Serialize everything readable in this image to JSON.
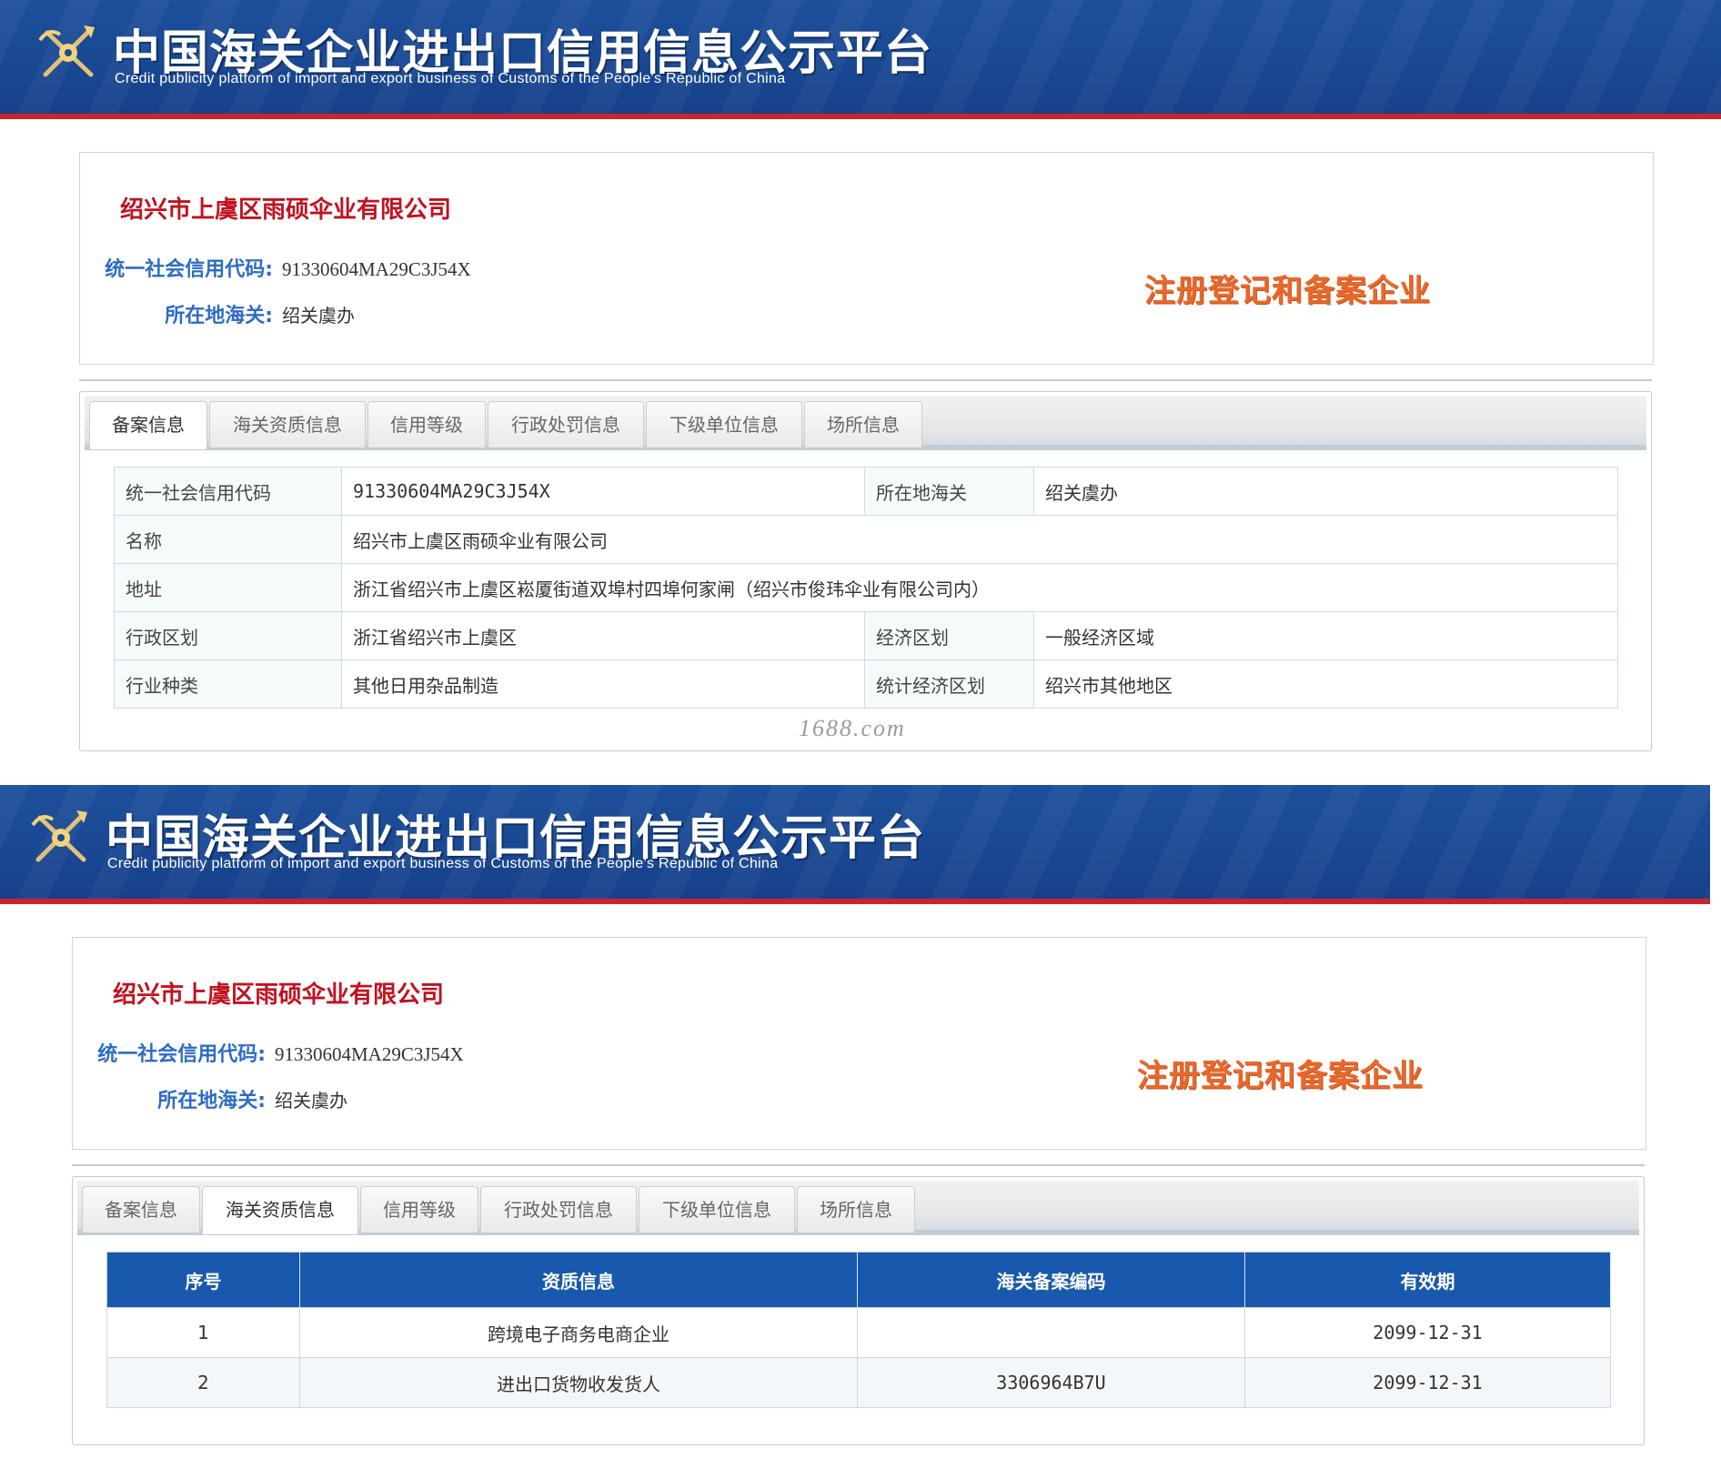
{
  "site": {
    "title": "中国海关企业进出口信用信息公示平台",
    "subtitle": "Credit publicity platform of import and export business of Customs of the People's Republic of China"
  },
  "company": {
    "name": "绍兴市上虞区雨硕伞业有限公司",
    "credit_code_label": "统一社会信用代码:",
    "credit_code": "91330604MA29C3J54X",
    "customs_label": "所在地海关:",
    "customs": "绍关虞办",
    "registration_badge": "注册登记和备案企业"
  },
  "tabs": [
    {
      "label": "备案信息"
    },
    {
      "label": "海关资质信息"
    },
    {
      "label": "信用等级"
    },
    {
      "label": "行政处罚信息"
    },
    {
      "label": "下级单位信息"
    },
    {
      "label": "场所信息"
    }
  ],
  "record": {
    "credit_code_label": "统一社会信用代码",
    "credit_code": "91330604MA29C3J54X",
    "customs_label": "所在地海关",
    "customs": "绍关虞办",
    "name_label": "名称",
    "name": "绍兴市上虞区雨硕伞业有限公司",
    "address_label": "地址",
    "address": "浙江省绍兴市上虞区崧厦街道双埠村四埠何家闸（绍兴市俊玮伞业有限公司内）",
    "admin_region_label": "行政区划",
    "admin_region": "浙江省绍兴市上虞区",
    "economic_region_label": "经济区划",
    "economic_region": "一般经济区域",
    "industry_label": "行业种类",
    "industry": "其他日用杂品制造",
    "stat_region_label": "统计经济区划",
    "stat_region": "绍兴市其他地区"
  },
  "watermark": "1688.com",
  "qualification": {
    "headers": [
      "序号",
      "资质信息",
      "海关备案编码",
      "有效期"
    ],
    "rows": [
      [
        "1",
        "跨境电子商务电商企业",
        "",
        "2099-12-31"
      ],
      [
        "2",
        "进出口货物收发货人",
        "3306964B7U",
        "2099-12-31"
      ]
    ]
  },
  "colors": {
    "banner": "#1a4a95",
    "banner_stripe": "#c9252b",
    "company_name": "#c1121f",
    "label_blue": "#2c6cc6",
    "badge_orange": "#e8682c",
    "table_header": "#1859ad"
  }
}
